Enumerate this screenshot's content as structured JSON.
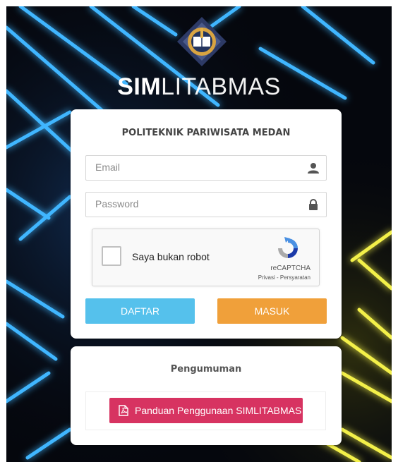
{
  "app": {
    "brand_bold": "SIM",
    "brand_light": "LITABMAS"
  },
  "login": {
    "institution": "POLITEKNIK PARIWISATA MEDAN",
    "email_placeholder": "Email",
    "password_placeholder": "Password",
    "captcha_label": "Saya bukan robot",
    "captcha_brand": "reCAPTCHA",
    "captcha_links": "Privasi - Persyaratan",
    "register_label": "DAFTAR",
    "login_label": "MASUK"
  },
  "announcement": {
    "title": "Pengumuman",
    "guide_label": "Panduan Penggunaan SIMLITABMAS"
  },
  "icons": {
    "email_field": "user-icon",
    "password_field": "lock-icon",
    "guide": "pdf-icon"
  },
  "colors": {
    "register_button": "#55c1ec",
    "login_button": "#f0a03a",
    "guide_button": "#d73361",
    "background": "#05070d",
    "neon_blue": "#3fb6ff",
    "neon_yellow": "#f3f04a"
  }
}
